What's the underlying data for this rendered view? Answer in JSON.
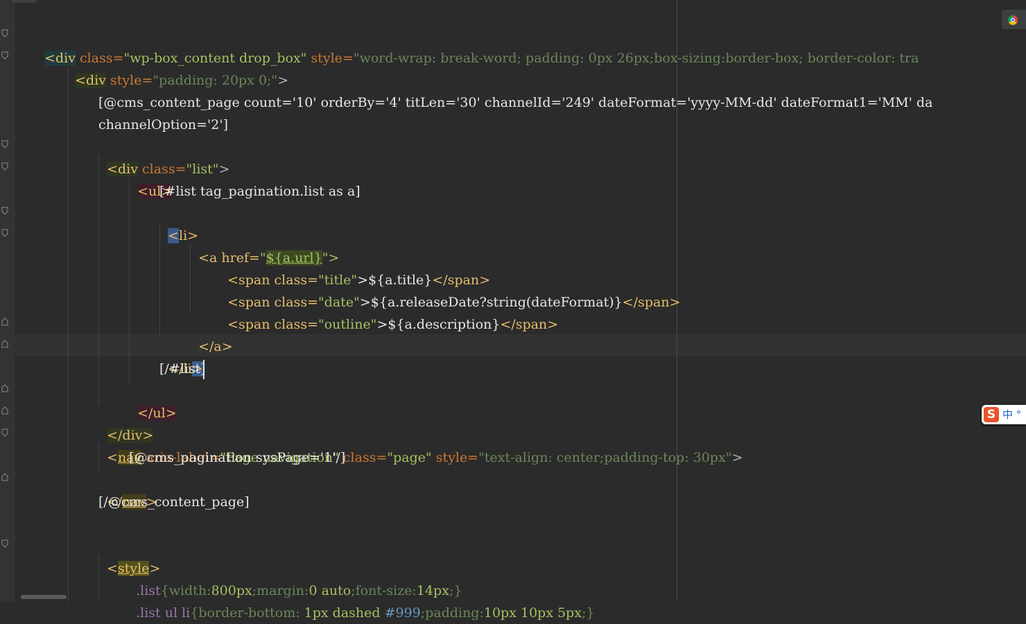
{
  "editor": {
    "lines": [
      {
        "id": "l1"
      },
      {
        "id": "l2"
      }
    ]
  },
  "code": {
    "l1_a": "<div",
    "l1_b": " class=",
    "l1_c": "\"wp-box_content drop_box\"",
    "l1_d": " style=",
    "l1_e": "\"word-wrap: break-word; padding: 0px 26px;box-sizing:border-box; border-color: tra",
    "l2_a": "<div",
    "l2_b": " style=",
    "l2_c": "\"padding: 20px 0;\"",
    "l2_d": ">",
    "l4": "[@cms_content_page count='10' orderBy='4' titLen='30' channelId='249' dateFormat='yyyy-MM-dd' dateFormat1='MM' da",
    "l5": "channelOption='2']",
    "l6_a": "<div",
    "l6_b": " class=",
    "l6_c": "\"list\"",
    "l6_d": ">",
    "l7": "<ul>",
    "l8": "[#list tag_pagination.list as a]",
    "l9_a": "<",
    "l9_b": "li>",
    "l10_a": "<a href=",
    "l10_b": "\"",
    "l10_c": "${a.url}",
    "l10_d": "\">",
    "l11_a": "<span class=",
    "l11_b": "\"title\"",
    "l11_c": ">${a.title}",
    "l11_d": "</span>",
    "l12_a": "<span class=",
    "l12_b": "\"date\"",
    "l12_c": ">${a.releaseDate?string(dateFormat)}",
    "l12_d": "</span>",
    "l13_a": "<span class=",
    "l13_b": "\"outline\"",
    "l13_c": ">${a.description}",
    "l13_d": "</span>",
    "l14": "</a>",
    "l15_a": "</li",
    "l15_b": ">",
    "l16": "[/#list]",
    "l17": "</ul>",
    "l18": "</div>",
    "l19_a": "<",
    "l19_b": "nav",
    "l19_c": " aria-label=",
    "l19_d": "\"Page navigation\"",
    "l19_e": " class=",
    "l19_f": "\"page\"",
    "l19_g": " style=",
    "l19_h": "\"text-align: center;padding-top: 30px\"",
    "l19_i": ">",
    "l20": "[@cms_pagination sysPage='1'/]",
    "l21_a": "</",
    "l21_b": "nav",
    "l21_c": ">",
    "l22": "[/@cms_content_page]",
    "l24_a": "<",
    "l24_b": "style",
    "l24_c": ">",
    "l25_a": ".list",
    "l25_b": "{width:",
    "l25_c": "800px",
    "l25_d": ";margin:",
    "l25_e": "0 auto",
    "l25_f": ";font-size:",
    "l25_g": "14px",
    "l25_h": ";}",
    "l26_a": ".list ul li",
    "l26_b": "{border-bottom: ",
    "l26_c": "1px dashed",
    "l26_d": " #999",
    "l26_e": ";padding:",
    "l26_f": "10px 10px 5px",
    "l26_g": ";}"
  },
  "ime": {
    "text": "中 °"
  }
}
